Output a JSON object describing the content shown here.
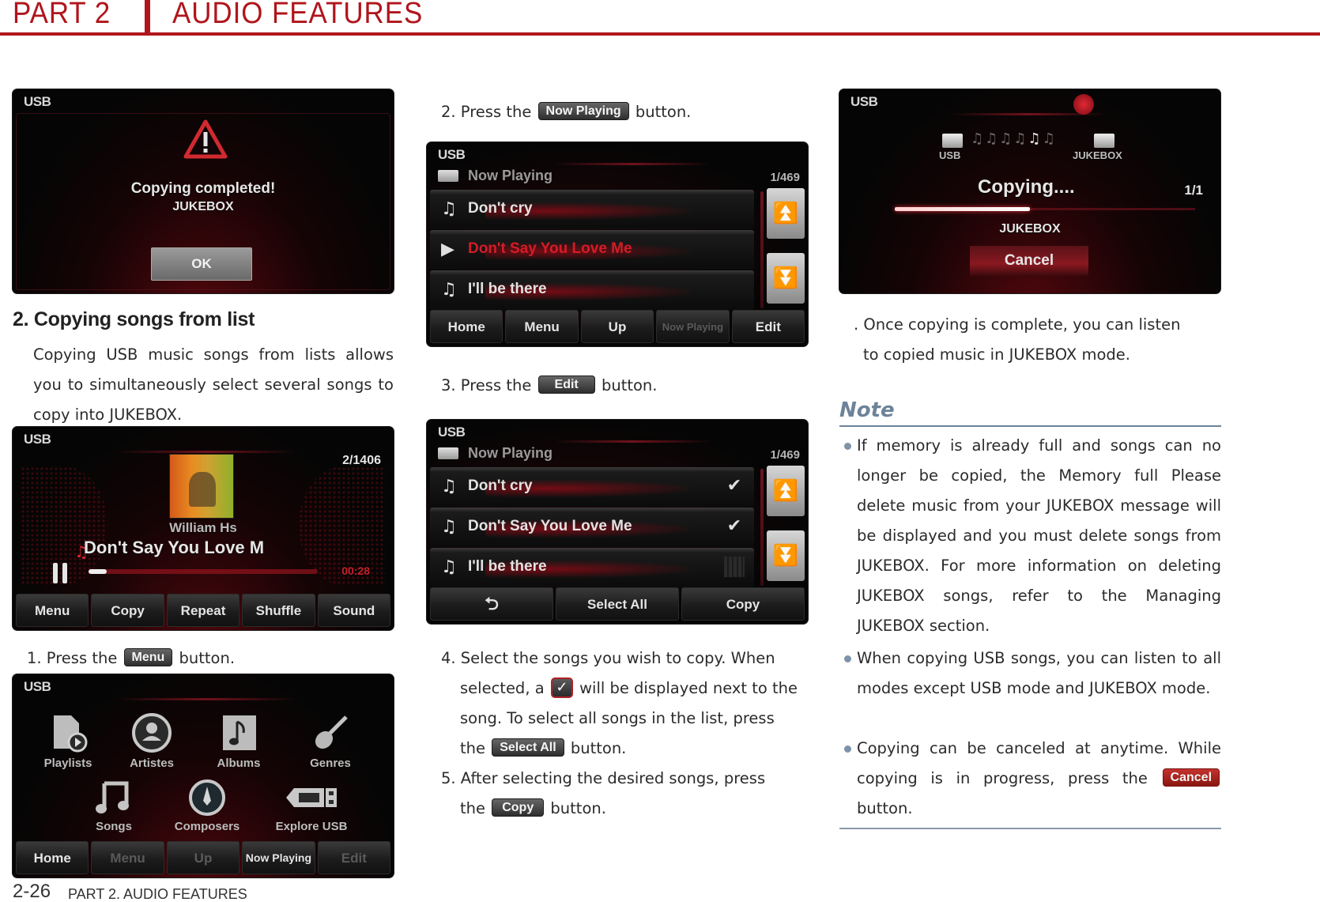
{
  "header": {
    "part": "PART 2",
    "title": "AUDIO FEATURES"
  },
  "section": {
    "heading": "2. Copying songs from list",
    "intro": "Copying USB music songs from lists allows you to simultaneously select several songs to copy into JUKEBOX."
  },
  "screens": {
    "completed": {
      "source": "USB",
      "message": "Copying completed!",
      "target": "JUKEBOX",
      "ok_label": "OK"
    },
    "playback": {
      "source": "USB",
      "track_count": "2/1406",
      "artist": "William Hs",
      "song": "Don't Say You Love M",
      "progress": 0.08,
      "time": "00:28",
      "buttons": [
        "Menu",
        "Copy",
        "Repeat",
        "Shuffle",
        "Sound"
      ]
    },
    "menu": {
      "source": "USB",
      "items": [
        {
          "label": "Playlists",
          "icon": "playlist-icon"
        },
        {
          "label": "Artistes",
          "icon": "artist-icon"
        },
        {
          "label": "Albums",
          "icon": "album-icon"
        },
        {
          "label": "Genres",
          "icon": "guitar-icon"
        },
        {
          "label": "Songs",
          "icon": "music-note-icon"
        },
        {
          "label": "Composers",
          "icon": "composer-icon"
        },
        {
          "label": "Explore USB",
          "icon": "usb-drive-icon"
        }
      ],
      "buttons": [
        {
          "label": "Home",
          "enabled": true
        },
        {
          "label": "Menu",
          "enabled": false
        },
        {
          "label": "Up",
          "enabled": false
        },
        {
          "label": "Now Playing",
          "enabled": true
        },
        {
          "label": "Edit",
          "enabled": false
        }
      ]
    },
    "now_playing": {
      "source": "USB",
      "header": "Now Playing",
      "count": "1/469",
      "songs": [
        {
          "title": "Don't cry",
          "state": "normal"
        },
        {
          "title": "Don't Say You Love Me",
          "state": "playing"
        },
        {
          "title": "I'll be there",
          "state": "normal"
        }
      ],
      "buttons": [
        {
          "label": "Home",
          "enabled": true
        },
        {
          "label": "Menu",
          "enabled": true
        },
        {
          "label": "Up",
          "enabled": true
        },
        {
          "label": "Now Playing",
          "enabled": false
        },
        {
          "label": "Edit",
          "enabled": true
        }
      ]
    },
    "edit": {
      "source": "USB",
      "header": "Now Playing",
      "count": "1/469",
      "songs": [
        {
          "title": "Don't cry",
          "checked": true
        },
        {
          "title": "Don't Say You Love Me",
          "checked": true
        },
        {
          "title": "I'll be there",
          "checked": false
        }
      ],
      "buttons": [
        "Back",
        "Select All",
        "Copy"
      ]
    },
    "copying": {
      "source": "USB",
      "from_label": "USB",
      "to_label": "JUKEBOX",
      "status": "Copying....",
      "count": "1/1",
      "progress": 0.45,
      "target": "JUKEBOX",
      "cancel_label": "Cancel"
    }
  },
  "steps": {
    "s1_pre": "1. Press the",
    "s1_btn": "Menu",
    "s1_post": "button.",
    "s2_pre": "2. Press the",
    "s2_btn": "Now Playing",
    "s2_post": "button.",
    "s3_pre": "3. Press the",
    "s3_btn": "Edit",
    "s3_post": "button.",
    "s4_a": "4. Select the songs you wish to copy. When",
    "s4_b_pre": "selected, a",
    "s4_b_post": "will be displayed next to the",
    "s4_c": "song. To select all songs in the list, press",
    "s4_d_pre": "the",
    "s4_d_btn": "Select All",
    "s4_d_post": "button.",
    "s5_a": "5. After selecting the desired songs, press",
    "s5_b_pre": "the",
    "s5_b_btn": "Copy",
    "s5_b_post": "button.",
    "s6_a": ". Once copying is complete, you can listen",
    "s6_b": "to copied music in JUKEBOX mode."
  },
  "note": {
    "title": "Note",
    "b1": "If memory is already full and songs can no longer be copied, the  Memory full  Please delete music from your JUKEBOX  message will be displayed and you must delete songs from JUKEBOX. For more information on deleting JUKEBOX songs, refer to the  Managing JUKEBOX  section.",
    "b2": "When copying USB songs, you can listen to all modes except USB mode and JUKEBOX mode.",
    "b3_pre": "Copying can be canceled at anytime. While copying is in progress, press the",
    "b3_btn": "Cancel",
    "b3_post": "button."
  },
  "footer": {
    "page": "2-26",
    "label": "PART 2. AUDIO FEATURES"
  }
}
